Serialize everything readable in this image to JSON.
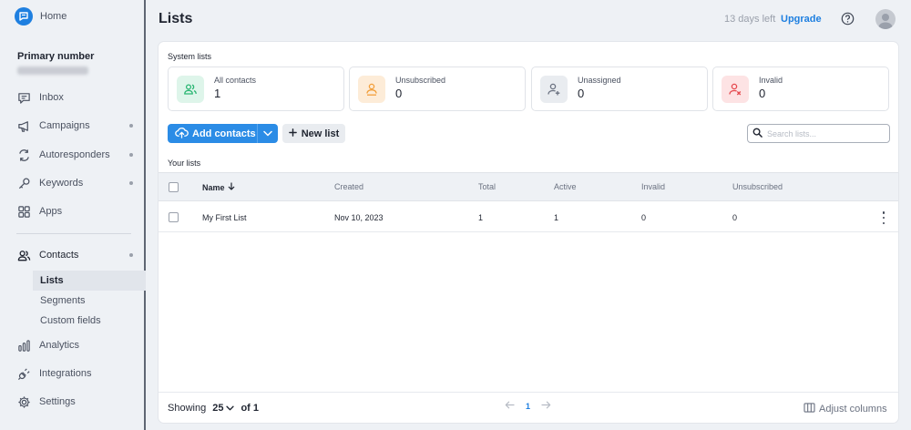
{
  "sidebar": {
    "home_label": "Home",
    "primary_title": "Primary number",
    "nav": [
      {
        "label": "Inbox"
      },
      {
        "label": "Campaigns"
      },
      {
        "label": "Autoresponders"
      },
      {
        "label": "Keywords"
      },
      {
        "label": "Apps"
      },
      {
        "label": "Contacts"
      },
      {
        "label": "Analytics"
      },
      {
        "label": "Integrations"
      },
      {
        "label": "Settings"
      }
    ],
    "contacts_sub": [
      {
        "label": "Lists"
      },
      {
        "label": "Segments"
      },
      {
        "label": "Custom fields"
      }
    ]
  },
  "header": {
    "title": "Lists",
    "days_left": "13 days left",
    "upgrade": "Upgrade"
  },
  "system_lists": {
    "title": "System lists",
    "items": [
      {
        "label": "All contacts",
        "count": "1",
        "color": "#2bb673",
        "bg": "#def5ea"
      },
      {
        "label": "Unsubscribed",
        "count": "0",
        "color": "#f29f3b",
        "bg": "#fdecd8"
      },
      {
        "label": "Unassigned",
        "count": "0",
        "color": "#6a7180",
        "bg": "#e9ecf0"
      },
      {
        "label": "Invalid",
        "count": "0",
        "color": "#e5484d",
        "bg": "#fde3e4"
      }
    ]
  },
  "toolbar": {
    "add_contacts": "Add contacts",
    "new_list": "New list",
    "search_placeholder": "Search lists..."
  },
  "your_lists": {
    "title": "Your lists",
    "columns": [
      "Name",
      "Created",
      "Total",
      "Active",
      "Invalid",
      "Unsubscribed"
    ],
    "rows": [
      {
        "name": "My First List",
        "created": "Nov 10, 2023",
        "total": "1",
        "active": "1",
        "invalid": "0",
        "unsubscribed": "0"
      }
    ]
  },
  "footer": {
    "showing": "Showing",
    "page_size": "25",
    "of": "of 1",
    "page": "1",
    "adjust": "Adjust columns"
  },
  "colors": {
    "accent": "#1e7fe0",
    "button": "#2b8ce6"
  }
}
